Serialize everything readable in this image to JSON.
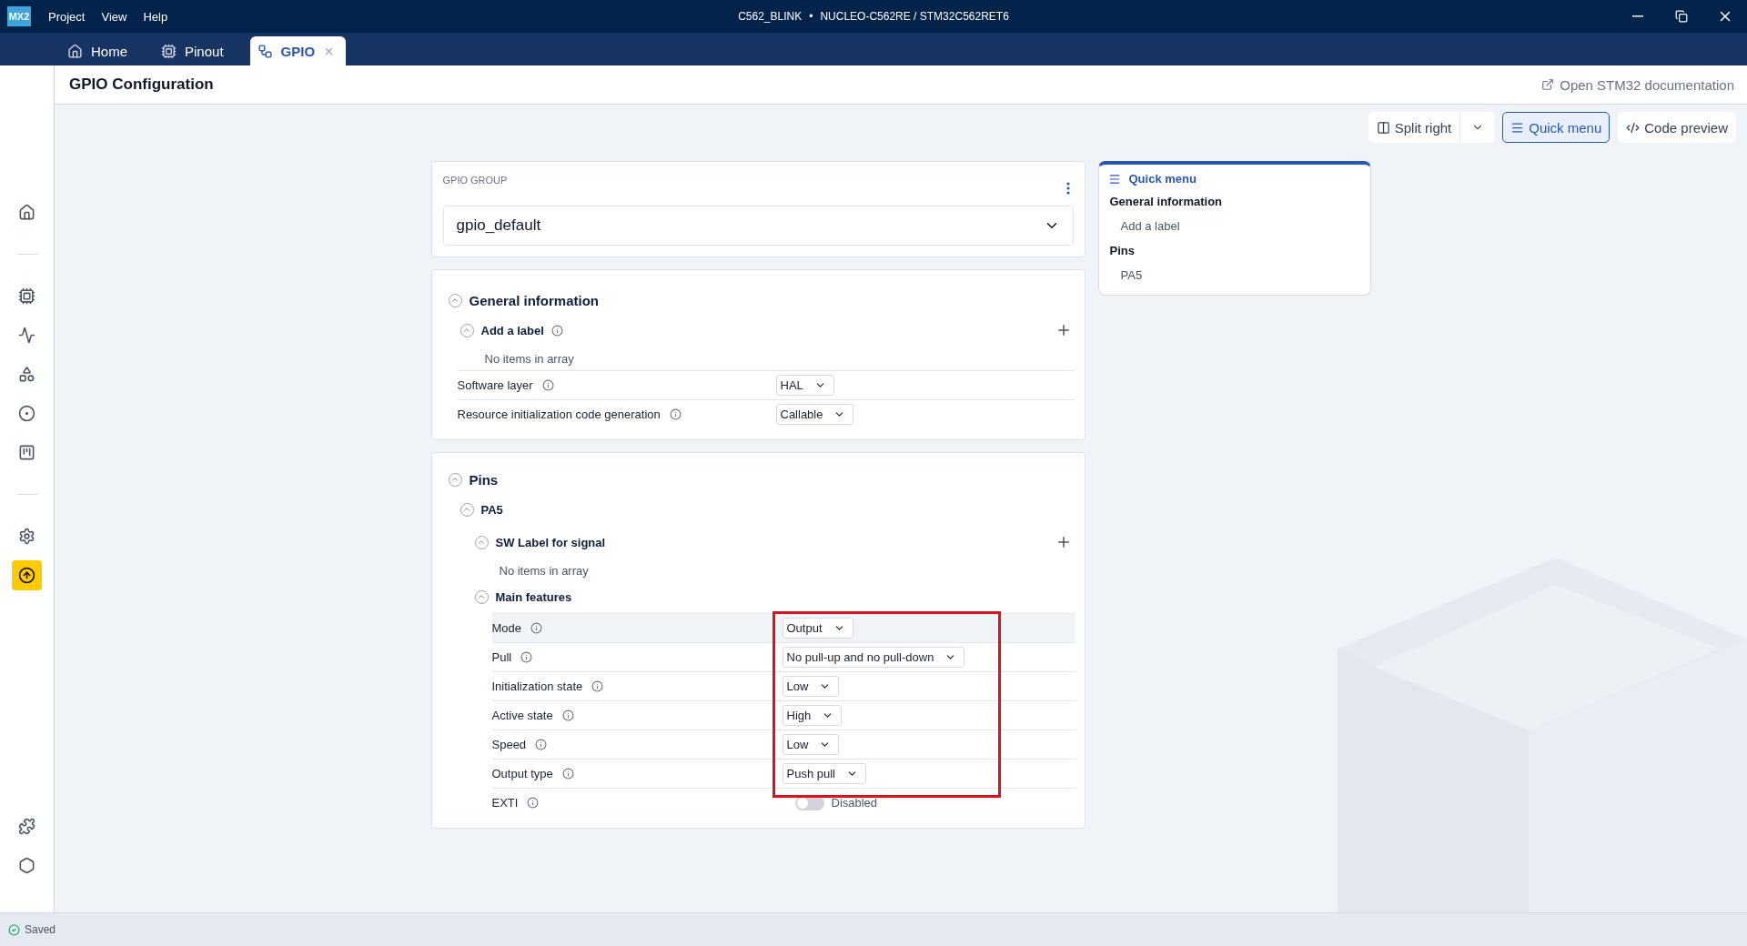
{
  "app": {
    "logo": "MX2",
    "menu": [
      "Project",
      "View",
      "Help"
    ],
    "project": "C562_BLINK",
    "separator": "•",
    "board": "NUCLEO-C562RE / STM32C562RET6"
  },
  "tabs": [
    {
      "label": "Home",
      "kind": "home",
      "selected": false,
      "closable": false
    },
    {
      "label": "Pinout",
      "kind": "chip",
      "selected": false,
      "closable": false
    },
    {
      "label": "GPIO",
      "kind": "gpio",
      "selected": true,
      "closable": true
    }
  ],
  "sidebar": {
    "items": [
      {
        "selected": false
      },
      {
        "selected": false
      },
      {
        "selected": false
      },
      {
        "selected": false
      },
      {
        "selected": false
      },
      {
        "selected": false
      },
      {
        "selected": false
      },
      {
        "selected": true
      },
      {
        "selected": false
      },
      {
        "selected": false
      }
    ]
  },
  "page": {
    "title": "GPIO Configuration",
    "doc_link": "Open STM32 documentation"
  },
  "toolbar": [
    {
      "label": "Split right",
      "kind": "split",
      "selected": false
    },
    {
      "label": "Quick menu",
      "kind": "menu",
      "selected": true
    },
    {
      "label": "Code preview",
      "kind": "code",
      "selected": false
    }
  ],
  "gpio_group": {
    "label": "GPIO GROUP",
    "value": "gpio_default"
  },
  "general": {
    "title": "General information",
    "expanded": true,
    "add_label": {
      "title": "Add a label",
      "expanded": true,
      "empty": "No items in array"
    },
    "fields": [
      {
        "label": "Software layer",
        "value": "HAL"
      },
      {
        "label": "Resource initialization code generation",
        "value": "Callable"
      }
    ]
  },
  "pins": {
    "title": "Pins",
    "expanded": true,
    "pin": {
      "name": "PA5",
      "expanded": true,
      "sw_label": {
        "title": "SW Label for signal",
        "expanded": true,
        "empty": "No items in array"
      },
      "main_features": {
        "title": "Main features",
        "expanded": true,
        "fields": [
          {
            "label": "Mode",
            "kind": "select",
            "value": "Output",
            "highlighted": true
          },
          {
            "label": "Pull",
            "kind": "select",
            "value": "No pull-up and no pull-down",
            "highlighted": false
          },
          {
            "label": "Initialization state",
            "kind": "select",
            "value": "Low",
            "highlighted": false
          },
          {
            "label": "Active state",
            "kind": "select",
            "value": "High",
            "highlighted": false
          },
          {
            "label": "Speed",
            "kind": "select",
            "value": "Low",
            "highlighted": false
          },
          {
            "label": "Output type",
            "kind": "select",
            "value": "Push pull",
            "highlighted": false
          },
          {
            "label": "EXTI",
            "kind": "toggle",
            "value": "Disabled",
            "on": false,
            "highlighted": false
          }
        ]
      }
    }
  },
  "quick_menu": {
    "title": "Quick menu",
    "items": [
      {
        "label": "General information",
        "children": [
          {
            "label": "Add a label"
          }
        ]
      },
      {
        "label": "Pins",
        "children": [
          {
            "label": "PA5"
          }
        ]
      }
    ]
  },
  "status": {
    "text": "Saved"
  }
}
